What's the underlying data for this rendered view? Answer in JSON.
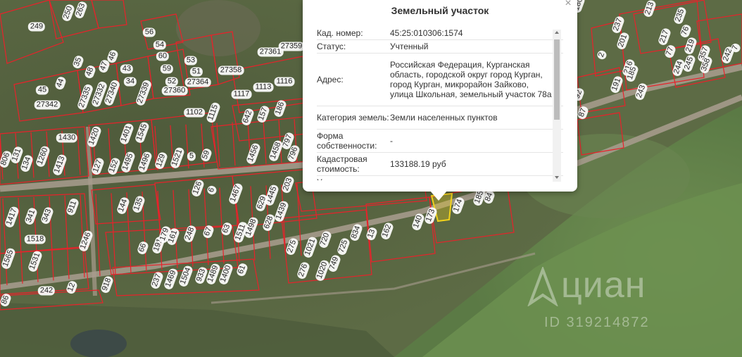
{
  "popup": {
    "title": "Земельный участок",
    "close_label": "×",
    "rows": [
      {
        "key": "Кад. номер:",
        "value": "45:25:010306:1574"
      },
      {
        "key": "Статус:",
        "value": "Учтенный"
      },
      {
        "key": "Адрес:",
        "value": "Российская Федерация, Курганская область, городской округ город Курган, город Курган, микрорайон Зайково, улица Школьная, земельный участок 78а"
      },
      {
        "key": "Категория земель:",
        "value": "Земли населенных пунктов"
      },
      {
        "key": "Форма собственности:",
        "value": "-"
      },
      {
        "key": "Кадастровая стоимость:",
        "value": "133188.19 руб"
      },
      {
        "key": "Уточненная",
        "value": ""
      }
    ]
  },
  "watermark": {
    "brand": "циан",
    "id_text": "ID 319214872"
  },
  "plot_labels": [
    "249",
    "250",
    "263",
    "35",
    "56",
    "54",
    "60",
    "59",
    "52",
    "53",
    "51",
    "43",
    "34",
    "46",
    "47",
    "48",
    "45",
    "44",
    "27342",
    "27335",
    "27332",
    "27340",
    "27339",
    "27360",
    "27364",
    "27361",
    "27359",
    "27358",
    "1117",
    "1113",
    "1116",
    "1102",
    "1115",
    "642",
    "157",
    "186",
    "1430",
    "806",
    "131",
    "134",
    "1260",
    "1413",
    "1420",
    "127",
    "1401",
    "1545",
    "152",
    "1495",
    "1496",
    "129",
    "1521",
    "5",
    "59",
    "1456",
    "1458",
    "797",
    "796",
    "203",
    "1445",
    "1439",
    "629",
    "628",
    "1467",
    "126",
    "6",
    "911",
    "1417",
    "341",
    "343",
    "1518",
    "1565",
    "1531",
    "1246",
    "144",
    "135",
    "66",
    "191",
    "179",
    "161",
    "248",
    "67",
    "63",
    "1511",
    "1498",
    "275",
    "1021",
    "720",
    "725",
    "834",
    "13",
    "162",
    "140",
    "173",
    "174",
    "185",
    "84",
    "276",
    "1020",
    "749",
    "242",
    "12",
    "918",
    "237",
    "1469",
    "1504",
    "933",
    "1489",
    "1400",
    "61",
    "86",
    "237",
    "201",
    "2",
    "216",
    "185",
    "191",
    "243",
    "87",
    "92",
    "180",
    "213",
    "235",
    "217",
    "76",
    "77",
    "219",
    "244",
    "245",
    "357",
    "358",
    "242",
    "7"
  ],
  "colors": {
    "parcel_line": "#e8222a",
    "highlight": "#f2d21b",
    "road": "#a99d8f"
  }
}
